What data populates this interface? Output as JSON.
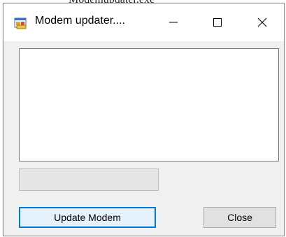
{
  "backdrop": {
    "partial_text": "Modemupdater.exe"
  },
  "window": {
    "title": "Modem updater....",
    "icon": "app-window-icon",
    "controls": {
      "minimize_icon": "minimize-icon",
      "maximize_icon": "maximize-icon",
      "close_icon": "close-icon"
    }
  },
  "log": {
    "text": ""
  },
  "progress": {
    "value": 0
  },
  "buttons": {
    "update_label": "Update Modem",
    "close_label": "Close"
  },
  "colors": {
    "focus_border": "#0078d7",
    "button_face": "#e1e1e1",
    "window_bg": "#f0f0f0"
  }
}
